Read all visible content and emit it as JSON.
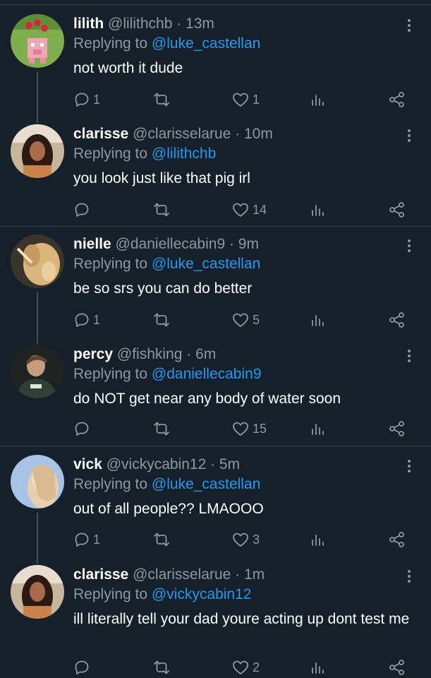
{
  "tweets": [
    {
      "name": "lilith",
      "handle": "@lilithchb",
      "time": "· 13m",
      "replying_prefix": "Replying to ",
      "replying_to": "@luke_castellan",
      "text": "not worth it dude",
      "replies": "1",
      "likes": "1",
      "avatar_icon": "pig-avatar"
    },
    {
      "name": "clarisse",
      "handle": "@clarisselarue",
      "time": "· 10m",
      "replying_prefix": "Replying to ",
      "replying_to": "@lilithchb",
      "text": "you look just like that pig irl",
      "replies": "",
      "likes": "14",
      "avatar_icon": "woman-dark-hair-avatar"
    },
    {
      "name": "nielle",
      "handle": "@daniellecabin9",
      "time": "· 9m",
      "replying_prefix": "Replying to ",
      "replying_to": "@luke_castellan",
      "text": "be so srs you can do better",
      "replies": "1",
      "likes": "5",
      "avatar_icon": "blonde-hair-avatar"
    },
    {
      "name": "percy",
      "handle": "@fishking",
      "time": "· 6m",
      "replying_prefix": "Replying to ",
      "replying_to": "@daniellecabin9",
      "text": "do NOT get near any body of water soon",
      "replies": "",
      "likes": "15",
      "avatar_icon": "boy-hoodie-avatar"
    },
    {
      "name": "vick",
      "handle": "@vickycabin12",
      "time": "· 5m",
      "replying_prefix": "Replying to ",
      "replying_to": "@luke_castellan",
      "text": "out of all people?? LMAOOO",
      "replies": "1",
      "likes": "3",
      "avatar_icon": "blonde-sky-avatar"
    },
    {
      "name": "clarisse",
      "handle": "@clarisselarue",
      "time": "· 1m",
      "replying_prefix": "Replying to ",
      "replying_to": "@vickycabin12",
      "text": "ill literally tell your dad youre acting up dont test me",
      "replies": "",
      "likes": "2",
      "avatar_icon": "woman-dark-hair-avatar"
    }
  ],
  "colors": {
    "background": "#15202b",
    "muted": "#8b98a5",
    "link": "#1d9bf0",
    "divider": "#38444d"
  },
  "icons": [
    "reply-icon",
    "retweet-icon",
    "like-icon",
    "analytics-icon",
    "share-icon",
    "more-icon"
  ]
}
